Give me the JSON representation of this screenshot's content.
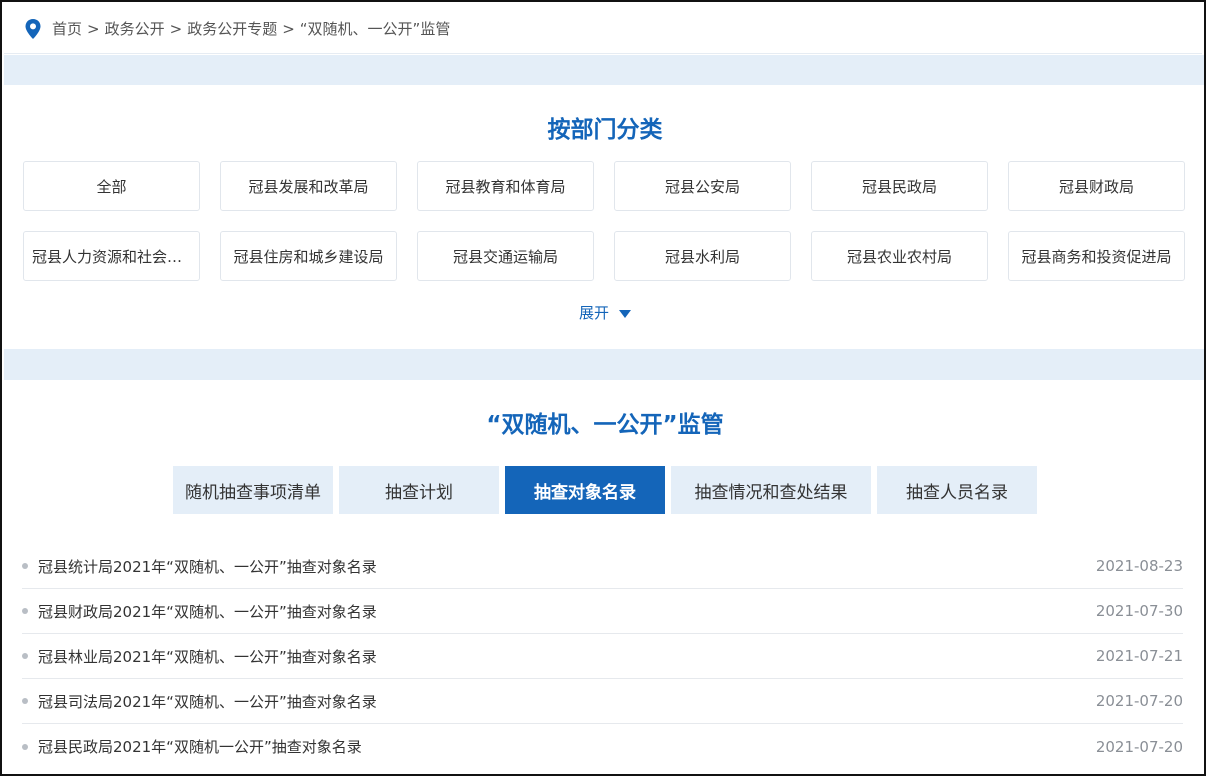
{
  "breadcrumb": {
    "items": [
      "首页",
      "政务公开",
      "政务公开专题",
      "“双随机、一公开”监管"
    ],
    "separator": ">"
  },
  "dept_section": {
    "title": "按部门分类",
    "departments": [
      "全部",
      "冠县发展和改革局",
      "冠县教育和体育局",
      "冠县公安局",
      "冠县民政局",
      "冠县财政局",
      "冠县人力资源和社会保障局",
      "冠县住房和城乡建设局",
      "冠县交通运输局",
      "冠县水利局",
      "冠县农业农村局",
      "冠县商务和投资促进局"
    ],
    "expand_label": "展开"
  },
  "supervision_section": {
    "title": "“双随机、一公开”监管",
    "tabs": [
      {
        "label": "随机抽查事项清单",
        "active": false
      },
      {
        "label": "抽查计划",
        "active": false
      },
      {
        "label": "抽查对象名录",
        "active": true
      },
      {
        "label": "抽查情况和查处结果",
        "active": false
      },
      {
        "label": "抽查人员名录",
        "active": false
      }
    ],
    "list": [
      {
        "title": "冠县统计局2021年“双随机、一公开”抽查对象名录",
        "date": "2021-08-23"
      },
      {
        "title": "冠县财政局2021年“双随机、一公开”抽查对象名录",
        "date": "2021-07-30"
      },
      {
        "title": "冠县林业局2021年“双随机、一公开”抽查对象名录",
        "date": "2021-07-21"
      },
      {
        "title": "冠县司法局2021年“双随机、一公开”抽查对象名录",
        "date": "2021-07-20"
      },
      {
        "title": "冠县民政局2021年“双随机一公开”抽查对象名录",
        "date": "2021-07-20"
      }
    ]
  },
  "colors": {
    "accent": "#1465b9",
    "band": "#e4eef8",
    "border": "#e1e6ec"
  },
  "icons": {
    "breadcrumb": "location-pin-icon",
    "expand": "triangle-down-icon",
    "bullet": "dot-icon"
  }
}
